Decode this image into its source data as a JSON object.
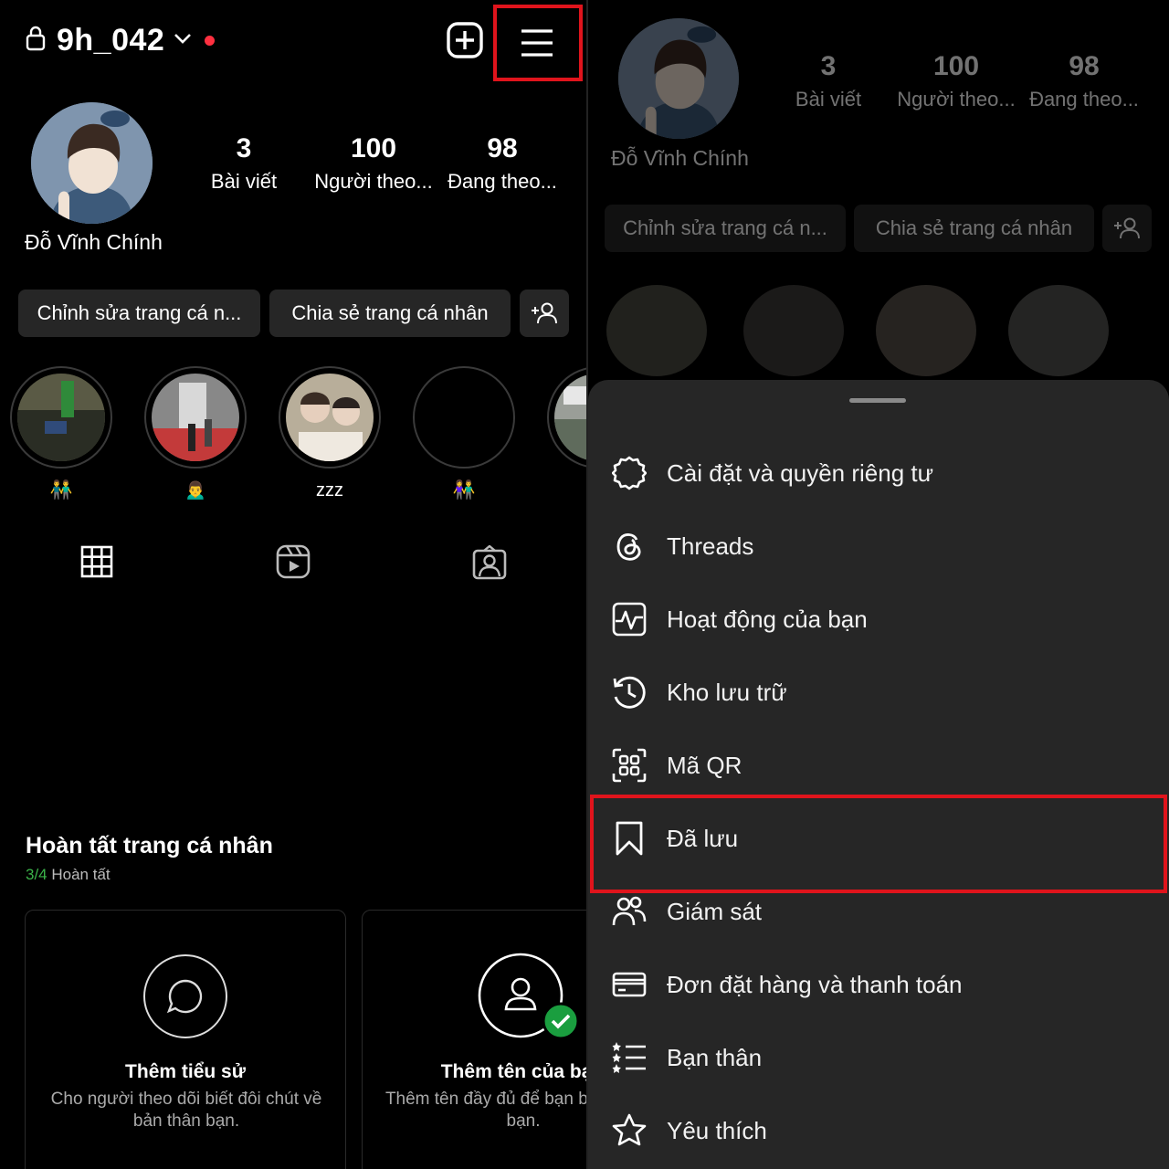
{
  "left": {
    "username": "9h_042",
    "display_name": "Đỗ Vĩnh Chính",
    "stats": [
      {
        "num": "3",
        "label": "Bài viết"
      },
      {
        "num": "100",
        "label": "Người theo..."
      },
      {
        "num": "98",
        "label": "Đang theo..."
      }
    ],
    "buttons": {
      "edit": "Chỉnh sửa trang cá n...",
      "share": "Chia sẻ trang cá nhân"
    },
    "stories": [
      {
        "label": "👬"
      },
      {
        "label": "🙍‍♂️"
      },
      {
        "label": "zzz"
      },
      {
        "label": "👫"
      }
    ],
    "complete": {
      "title": "Hoàn tất trang cá nhân",
      "progress": "3/4",
      "status": "Hoàn tất"
    },
    "cards": [
      {
        "title": "Thêm tiểu sử",
        "desc": "Cho người theo dõi biết đôi chút về bản thân bạn."
      },
      {
        "title": "Thêm tên của bạn",
        "desc": "Thêm tên đầy đủ để bạn bè nhận ra bạn."
      }
    ]
  },
  "right": {
    "display_name": "Đỗ Vĩnh Chính",
    "stats": [
      {
        "num": "3",
        "label": "Bài viết"
      },
      {
        "num": "100",
        "label": "Người theo..."
      },
      {
        "num": "98",
        "label": "Đang theo..."
      }
    ],
    "buttons": {
      "edit": "Chỉnh sửa trang cá n...",
      "share": "Chia sẻ trang cá nhân"
    },
    "menu": [
      {
        "label": "Cài đặt và quyền riêng tư",
        "icon": "settings-icon"
      },
      {
        "label": "Threads",
        "icon": "threads-icon"
      },
      {
        "label": "Hoạt động của bạn",
        "icon": "activity-icon"
      },
      {
        "label": "Kho lưu trữ",
        "icon": "archive-icon"
      },
      {
        "label": "Mã QR",
        "icon": "qr-code-icon"
      },
      {
        "label": "Đã lưu",
        "icon": "bookmark-icon"
      },
      {
        "label": "Giám sát",
        "icon": "supervision-icon"
      },
      {
        "label": "Đơn đặt hàng và thanh toán",
        "icon": "card-icon"
      },
      {
        "label": "Bạn thân",
        "icon": "close-friends-icon"
      },
      {
        "label": "Yêu thích",
        "icon": "star-icon"
      }
    ]
  },
  "colors": {
    "highlight": "#e0141c",
    "live_dot": "#ff3040",
    "check": "#1a9e3f",
    "sheet": "#262626",
    "button": "#262626"
  }
}
